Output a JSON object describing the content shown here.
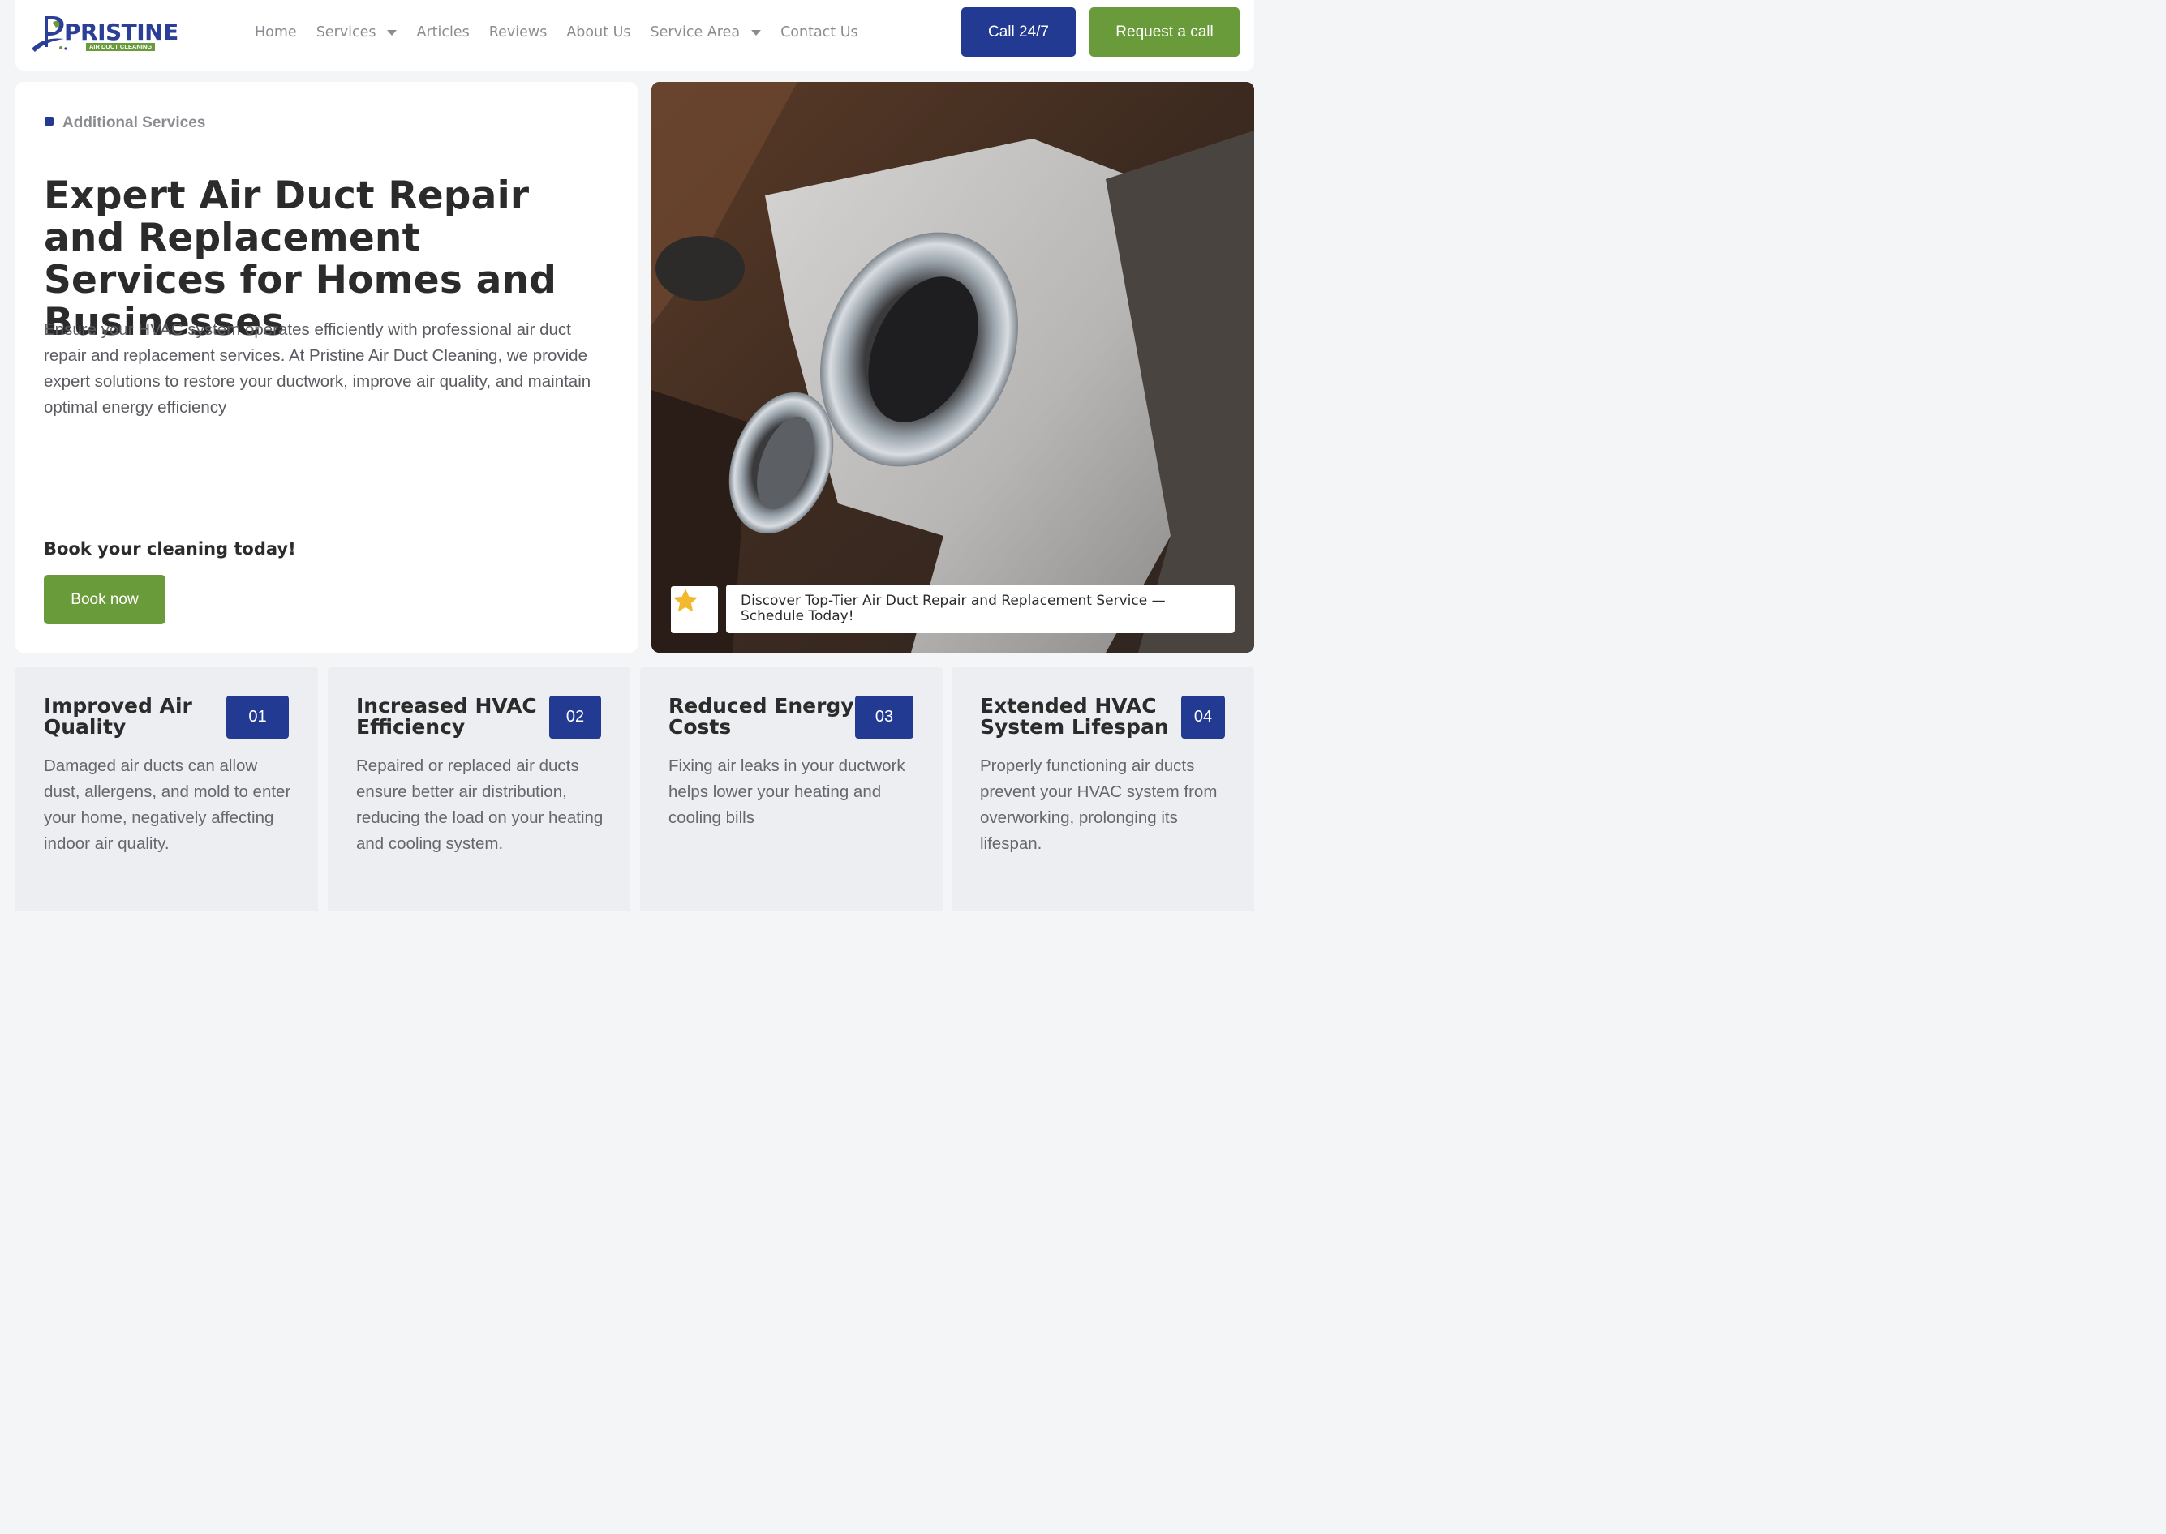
{
  "colors": {
    "brand_blue": "#233a93",
    "brand_green": "#6a9b3a",
    "page_bg": "#f4f5f7"
  },
  "logo": {
    "word": "PRISTINE",
    "sub": "AIR DUCT CLEANING"
  },
  "nav": {
    "items": [
      {
        "label": "Home",
        "dropdown": false
      },
      {
        "label": "Services",
        "dropdown": true
      },
      {
        "label": "Articles",
        "dropdown": false
      },
      {
        "label": "Reviews",
        "dropdown": false
      },
      {
        "label": "About Us",
        "dropdown": false
      },
      {
        "label": "Service Area",
        "dropdown": true
      },
      {
        "label": "Contact Us",
        "dropdown": false
      }
    ]
  },
  "header": {
    "call_label": "Call 24/7",
    "request_label": "Request a call"
  },
  "hero": {
    "kicker": "Additional Services",
    "title": "Expert Air Duct Repair and Replacement Services for Homes and Businesses",
    "description": "Ensure your HVAC system operates efficiently with professional air duct repair and replacement services. At Pristine Air Duct Cleaning, we provide expert solutions to restore your ductwork, improve air quality, and maintain optimal energy efficiency",
    "book_heading": "Book your cleaning today!",
    "book_label": "Book now",
    "image_caption": "Discover Top-Tier Air Duct Repair and Replacement Service — Schedule Today!",
    "image_icon": "star-icon"
  },
  "features": [
    {
      "title": "Improved Air Quality",
      "number": "01",
      "text": "Damaged air ducts can allow dust, allergens, and mold to enter your home, negatively affecting indoor air quality."
    },
    {
      "title": "Increased HVAC Efficiency",
      "number": "02",
      "text": "Repaired or replaced air ducts ensure better air distribution, reducing the load on your heating and cooling system."
    },
    {
      "title": "Reduced Energy Costs",
      "number": "03",
      "text": "Fixing air leaks in your ductwork helps lower your heating and cooling bills"
    },
    {
      "title": "Extended HVAC System Lifespan",
      "number": "04",
      "text": "Properly functioning air ducts prevent your HVAC system from overworking, prolonging its lifespan."
    }
  ]
}
